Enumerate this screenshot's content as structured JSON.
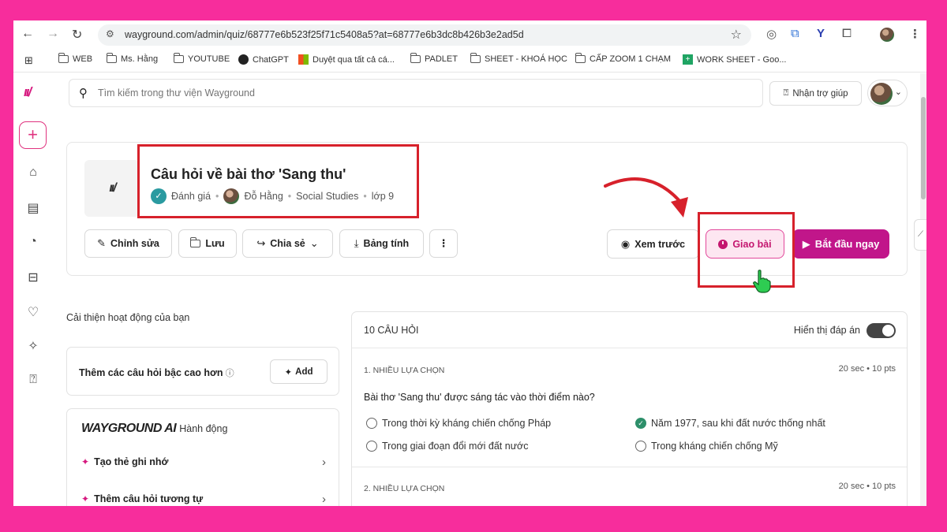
{
  "browser": {
    "url": "wayground.com/admin/quiz/68777e6b523f25f71c5408a5?at=68777e6b3dc8b426b3e2ad5d",
    "bookmarks": [
      "WEB",
      "Ms. Hằng",
      "YOUTUBE",
      "ChatGPT",
      "Duyệt qua tất cả cá...",
      "PADLET",
      "SHEET - KHOÁ HỌC",
      "CẤP ZOOM 1 CHẠM",
      "WORK SHEET - Goo..."
    ]
  },
  "topbar": {
    "search_placeholder": "Tìm kiếm trong thư viện Wayground",
    "help_label": "Nhận trợ giúp"
  },
  "quiz": {
    "title": "Câu hỏi về bài thơ 'Sang thu'",
    "category": "Đánh giá",
    "author": "Đỗ Hằng",
    "subject": "Social Studies",
    "grade": "lớp 9"
  },
  "actions": {
    "edit": "Chỉnh sửa",
    "save": "Lưu",
    "share": "Chia sẻ",
    "sheet": "Bảng tính",
    "preview": "Xem trước",
    "assign": "Giao bài",
    "start": "Bắt đầu ngay"
  },
  "left": {
    "improve_label": "Cải thiện hoạt động của bạn",
    "add_card_text": "Thêm các câu hỏi bậc cao hơn",
    "add_button": "Add",
    "ai_brand": "WAYGROUND",
    "ai_brand_suffix": "AI",
    "ai_subtitle": "Hành động",
    "ai_items": [
      "Tạo thẻ ghi nhớ",
      "Thêm câu hỏi tương tự"
    ]
  },
  "questions": {
    "count_label": "10 CÂU HỎI",
    "show_answers_label": "Hiển thị đáp án",
    "show_answers_on": true,
    "items": [
      {
        "type": "1. NHIỀU LỰA CHỌN",
        "meta": "20 sec • 10 pts",
        "text": "Bài thơ 'Sang thu' được sáng tác vào thời điểm nào?",
        "options": [
          {
            "label": "Trong thời kỳ kháng chiến chống Pháp",
            "correct": false
          },
          {
            "label": "Năm 1977, sau khi đất nước thống nhất",
            "correct": true
          },
          {
            "label": "Trong giai đoạn đổi mới đất nước",
            "correct": false
          },
          {
            "label": "Trong kháng chiến chống Mỹ",
            "correct": false
          }
        ]
      },
      {
        "type": "2. NHIỀU LỰA CHỌN",
        "meta": "20 sec • 10 pts"
      }
    ]
  },
  "colors": {
    "frame": "#f72d9c",
    "brand": "#d6197f",
    "assign_bg": "#fde6f1",
    "start_bg": "#c1168a",
    "highlight_red": "#d7212b",
    "correct_green": "#2d8f6a"
  },
  "icons": [
    "back-icon",
    "forward-icon",
    "reload-icon",
    "site-settings-icon",
    "bookmark-star-icon",
    "search-icon",
    "help-chat-icon",
    "edit-icon",
    "folder-icon",
    "share-icon",
    "download-icon",
    "more-icon",
    "eye-icon",
    "clock-icon",
    "play-icon",
    "sparkle-icon",
    "chevron-right-icon",
    "pointer-hand-icon"
  ]
}
